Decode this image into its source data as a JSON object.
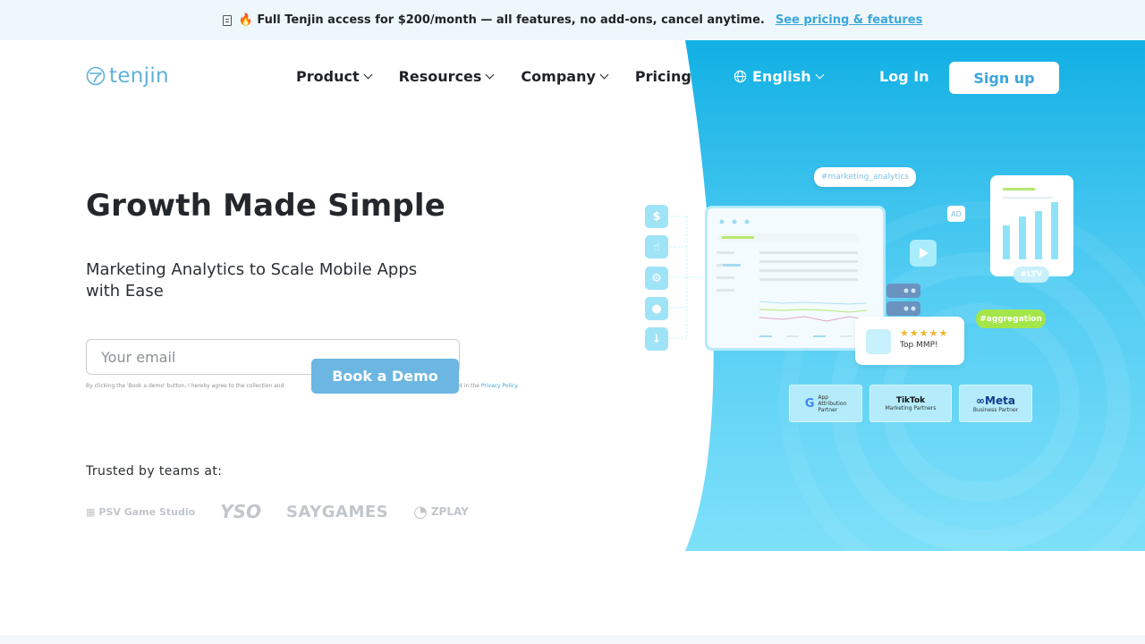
{
  "announcement": {
    "text": "🔥 Full Tenjin access for $200/month — all features, no add-ons, cancel anytime.",
    "link": "See pricing & features"
  },
  "header": {
    "logo_text": "tenjin",
    "nav": [
      {
        "label": "Product",
        "dropdown": true
      },
      {
        "label": "Resources",
        "dropdown": true
      },
      {
        "label": "Company",
        "dropdown": true
      },
      {
        "label": "Pricing",
        "dropdown": false
      }
    ],
    "language": "English",
    "login": "Log In",
    "signup": "Sign up"
  },
  "hero": {
    "title": "Growth Made Simple",
    "subtitle": "Marketing Analytics to Scale Mobile Apps with Ease",
    "email_placeholder": "Your email",
    "cta": "Book a Demo",
    "consent_before": "By clicking the 'Book a demo' button, I hereby agree to the collection and",
    "consent_after": "d in the",
    "consent_link": "Privacy Policy",
    "trusted_label": "Trusted by teams at:",
    "partners": [
      "PSV Game Studio",
      "YSO",
      "SAYGAMES",
      "ZPLAY"
    ]
  },
  "illustration": {
    "tag_marketing": "#marketing_analytics",
    "tag_aggregation": "#aggregation",
    "ad_label": "AD",
    "ltv_label": "#LTV",
    "review_stars": "★★★★★",
    "review_text": "Top MMP!",
    "badges": [
      {
        "brand": "G",
        "line1": "App",
        "line2": "Attribution",
        "line3": "Partner"
      },
      {
        "brand": "TikTok",
        "line1": "Marketing Partners"
      },
      {
        "brand": "∞Meta",
        "line1": "Business Partner"
      }
    ]
  },
  "colors": {
    "accent": "#3aa6dc",
    "panel_top": "#12b0e4",
    "panel_bottom": "#7ee0fa",
    "cta": "#6cb6e2"
  }
}
